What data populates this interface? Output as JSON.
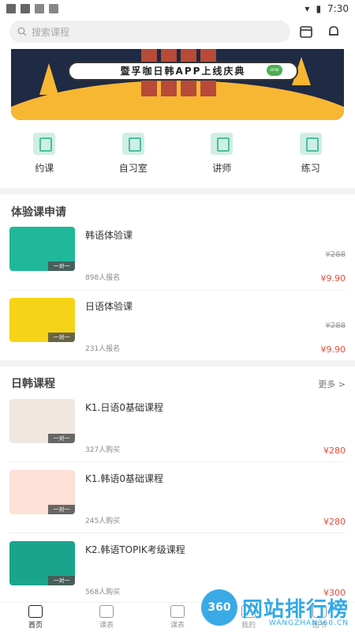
{
  "status": {
    "time": "7:30"
  },
  "search": {
    "placeholder": "搜索课程"
  },
  "banner": {
    "title": "暨孚咖日韩APP上线庆典",
    "tag": "one"
  },
  "quick_links": [
    "约课",
    "自习室",
    "讲师",
    "练习"
  ],
  "trial": {
    "title": "体验课申请",
    "items": [
      {
        "title": "韩语体验课",
        "count": "898人报名",
        "old_price": "¥288",
        "price": "¥9.90"
      },
      {
        "title": "日语体验课",
        "count": "231人报名",
        "old_price": "¥288",
        "price": "¥9.90"
      }
    ]
  },
  "courses": {
    "title": "日韩课程",
    "more": "更多 >",
    "items": [
      {
        "title": "K1.日语0基础课程",
        "count": "327人购买",
        "price": "¥280"
      },
      {
        "title": "K1.韩语0基础课程",
        "count": "245人购买",
        "price": "¥280"
      },
      {
        "title": "K2.韩语TOPIK考级课程",
        "count": "568人购买",
        "price": "¥300"
      }
    ]
  },
  "nav": [
    "首页",
    "课表",
    "课表",
    "我的",
    "图书"
  ],
  "watermark": {
    "num": "360",
    "text": "网站排行榜",
    "sub": "WANGZHAN360.CN"
  },
  "thumb_tag": "一对一"
}
